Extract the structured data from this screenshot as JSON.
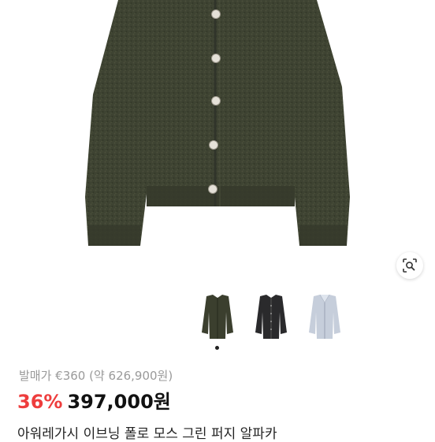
{
  "product": {
    "image_alt": "olive green cardigan",
    "thumbnails": [
      {
        "name": "green",
        "color": "#3b3f2e"
      },
      {
        "name": "black",
        "color": "#2a2a2c"
      },
      {
        "name": "light-blue",
        "color": "#c6cedb"
      }
    ],
    "active_thumb_index": 0,
    "original_price_text": "발매가 €360 (약 626,900원)",
    "discount_text": "36%",
    "sale_price_text": "397,000원",
    "title_text": "아워레가시 이브닝 폴로 모스 그린 퍼지 알파카"
  },
  "colors": {
    "discount": "#ee3d3d",
    "muted": "#9a9a9a",
    "garment": "#3d4231"
  },
  "icons": {
    "lens": "lens-search-icon"
  }
}
